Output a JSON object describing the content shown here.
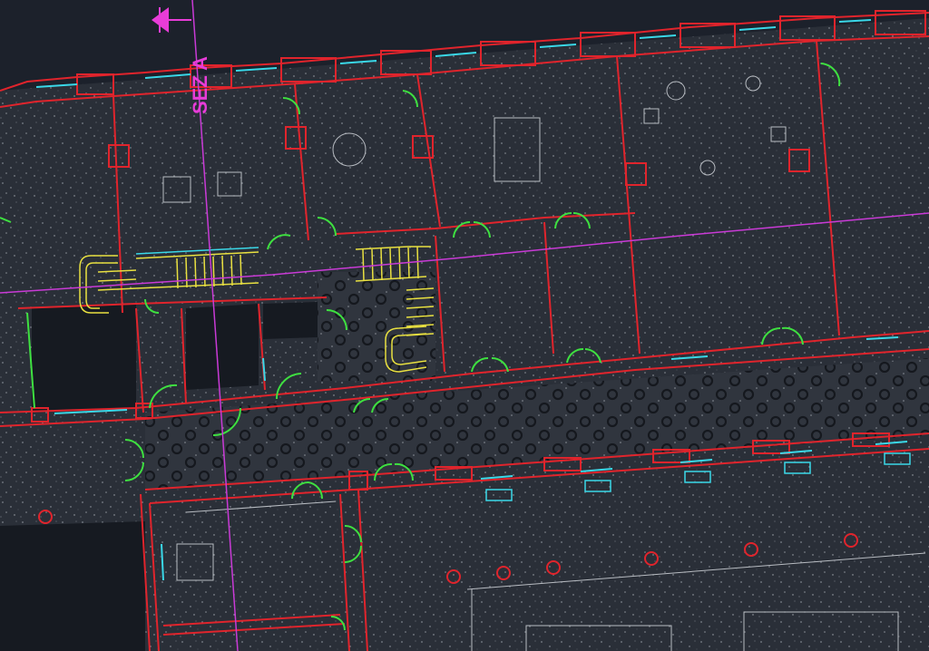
{
  "section_marker": {
    "label": "SEZ A",
    "color": "#e83cd8"
  },
  "layer_colors": {
    "walls": "#e0242c",
    "doors": "#3ee040",
    "stairs": "#e8e040",
    "windows": "#3ad8e8",
    "section_line": "#c93ad6",
    "point_cloud": "#c8ccd0",
    "background": "#1c212b"
  }
}
